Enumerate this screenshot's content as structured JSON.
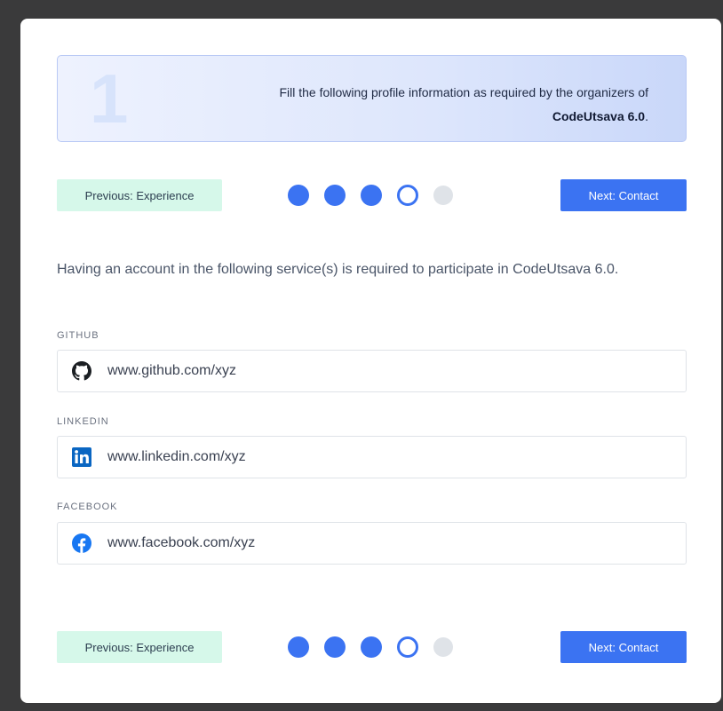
{
  "banner": {
    "step_number": "1",
    "text_before": "Fill the following profile information as required by the organizers of ",
    "event_name": "CodeUtsava 6.0",
    "text_after": "."
  },
  "nav": {
    "prev_label": "Previous: Experience",
    "next_label": "Next: Contact",
    "steps": [
      "done",
      "done",
      "done",
      "current",
      "pending"
    ]
  },
  "intro": "Having an account in the following service(s) is required to participate in CodeUtsava 6.0.",
  "fields": {
    "github": {
      "label": "GITHUB",
      "value": "www.github.com/xyz",
      "icon": "github-icon"
    },
    "linkedin": {
      "label": "LINKEDIN",
      "value": "www.linkedin.com/xyz",
      "icon": "linkedin-icon"
    },
    "facebook": {
      "label": "FACEBOOK",
      "value": "www.facebook.com/xyz",
      "icon": "facebook-icon"
    }
  },
  "colors": {
    "primary": "#3b73f2",
    "prev_button_bg": "#d6f8ea",
    "linkedin_brand": "#0a66c2",
    "facebook_brand": "#1877f2"
  }
}
